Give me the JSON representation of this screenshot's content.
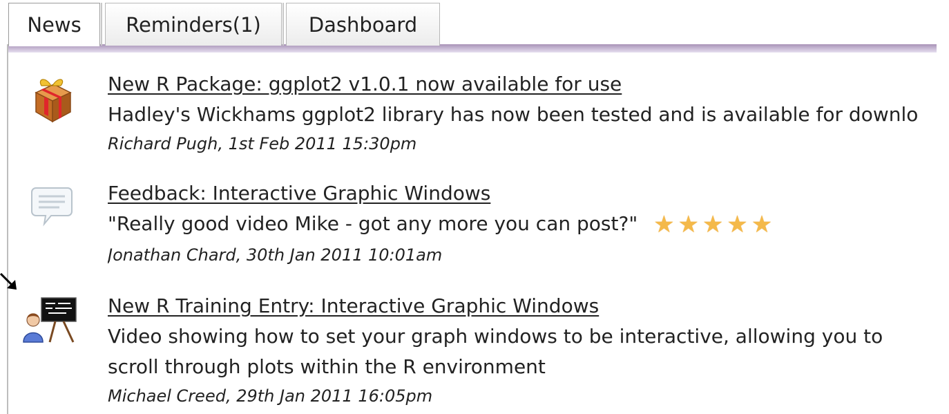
{
  "tabs": [
    {
      "label": "News",
      "active": true
    },
    {
      "label": "Reminders(1)",
      "active": false
    },
    {
      "label": "Dashboard",
      "active": false
    }
  ],
  "news": [
    {
      "icon": "package-icon",
      "title": "New R Package: ggplot2 v1.0.1 now available for use",
      "body": "Hadley's Wickhams ggplot2 library has now been tested and is available for downlo",
      "meta": "Richard Pugh, 1st Feb 2011 15:30pm"
    },
    {
      "icon": "feedback-icon",
      "title": "Feedback: Interactive Graphic Windows",
      "body": "\"Really good video Mike - got any more you can post?\"",
      "rating": 5,
      "rating_max": 5,
      "meta": "Jonathan Chard, 30th Jan 2011 10:01am"
    },
    {
      "icon": "training-icon",
      "title": "New R Training Entry: Interactive Graphic Windows",
      "body": "Video showing how to set your graph windows to be interactive, allowing you to",
      "body_line2": "scroll through plots within the R environment",
      "meta": "Michael Creed, 29th Jan 2011 16:05pm"
    }
  ],
  "colors": {
    "tab_underline": "#a893b7",
    "star": "#f4b94a",
    "text": "#222222"
  }
}
